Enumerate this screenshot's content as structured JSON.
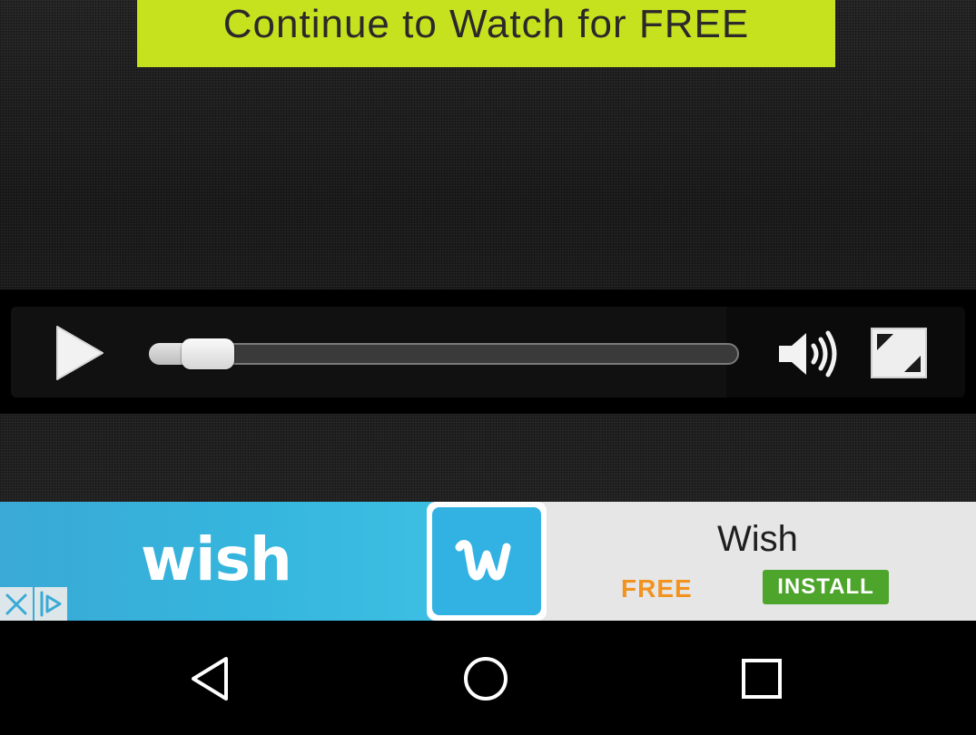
{
  "video": {
    "cta_label": "Continue to Watch for FREE"
  },
  "player": {
    "progress_fraction": 0.1,
    "icons": {
      "play": "play-icon",
      "volume": "volume-icon",
      "fullscreen": "fullscreen-icon"
    }
  },
  "ad": {
    "brand_wordmark": "wish",
    "logo_letter": "w",
    "app_name": "Wish",
    "price": "FREE",
    "install_label": "INSTALL",
    "colors": {
      "brand_blue": "#32b2e3",
      "install_green": "#4ea52c",
      "price_orange": "#f2931f"
    },
    "icons": {
      "close": "close-icon",
      "adchoices": "adchoices-icon"
    }
  },
  "system_nav": {
    "icons": [
      "back-icon",
      "home-icon",
      "recents-icon"
    ]
  },
  "colors": {
    "cta_background": "#c6e21f"
  }
}
